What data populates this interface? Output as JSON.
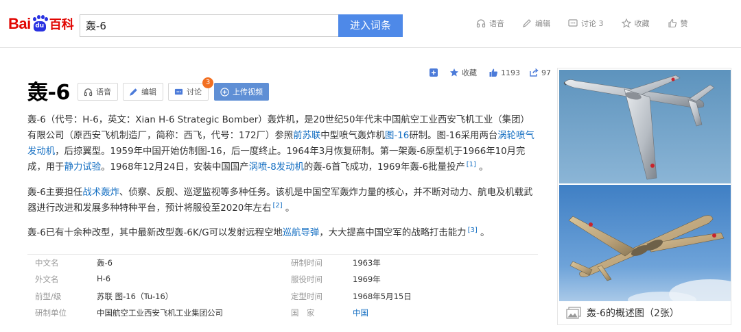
{
  "brand": {
    "bai": "Bai",
    "paw_text": "du",
    "baike": "百科"
  },
  "search": {
    "value": "轰-6",
    "button_label": "进入词条"
  },
  "top_actions": {
    "voice": "语音",
    "edit": "编辑",
    "discuss": "讨论 3",
    "collect": "收藏",
    "like": "赞"
  },
  "entry": {
    "title": "轰-6",
    "buttons": {
      "voice": "语音",
      "edit": "编辑",
      "discuss": "讨论",
      "discuss_badge": "3",
      "upload_video": "上传视频"
    },
    "meta": {
      "collect": "收藏",
      "likes": "1193",
      "shares": "97"
    }
  },
  "summary": {
    "p1": {
      "t1": "轰-6（代号：H-6，英文：Xian H-6 Strategic Bomber）轰炸机，是20世纪50年代末中国航空工业西安飞机工业（集团）有限公司（原西安飞机制造厂，简称：西飞，代号：172厂）参照",
      "l1": "前苏联",
      "t2": "中型喷气轰炸机",
      "l2": "图-16",
      "t3": "研制。图-16采用两台",
      "l3": "涡轮喷气发动机",
      "t4": "，后掠翼型。1959年中国开始仿制图-16，后一度终止。1964年3月恢复研制。第一架轰-6原型机于1966年10月完成，用于",
      "l4": "静力试验",
      "t5": "。1968年12月24日，安装中国国产",
      "l5": "涡喷-8发动机",
      "t6": "的轰-6首飞成功，1969年轰-6批量投产",
      "ref": "[1]",
      "t7": " 。"
    },
    "p2": {
      "t1": "轰-6主要担任",
      "l1": "战术轰炸",
      "t2": "、侦察、反舰、巡逻监视等多种任务。该机是中国空军轰炸力量的核心，并不断对动力、航电及机载武器进行改进和发展多种特种平台，预计将服役至2020年左右",
      "ref": "[2]",
      "t3": " 。"
    },
    "p3": {
      "t1": "轰-6已有十余种改型，其中最新改型轰-6K/G可以发射远程空地",
      "l1": "巡航导弹",
      "t2": "，大大提高中国空军的战略打击能力",
      "ref": "[3]",
      "t3": " 。"
    }
  },
  "basic_info": [
    {
      "k": "中文名",
      "v": "轰-6",
      "k2": "研制时间",
      "v2": "1963年"
    },
    {
      "k": "外文名",
      "v": "H-6",
      "k2": "服役时间",
      "v2": "1969年"
    },
    {
      "k": "前型/级",
      "v": "苏联 图-16（Tu-16）",
      "k2": "定型时间",
      "v2": "1968年5月15日"
    },
    {
      "k": "研制单位",
      "v": "中国航空工业西安飞机工业集团公司",
      "k2": "国　家",
      "v2": "中国"
    }
  ],
  "album": {
    "caption": "轰-6的概述图（2张）"
  },
  "colors": {
    "brand_red": "#e10602",
    "brand_blue": "#2932e1",
    "link": "#136ec2",
    "search_button": "#4e89e8",
    "badge": "#f26f21"
  }
}
